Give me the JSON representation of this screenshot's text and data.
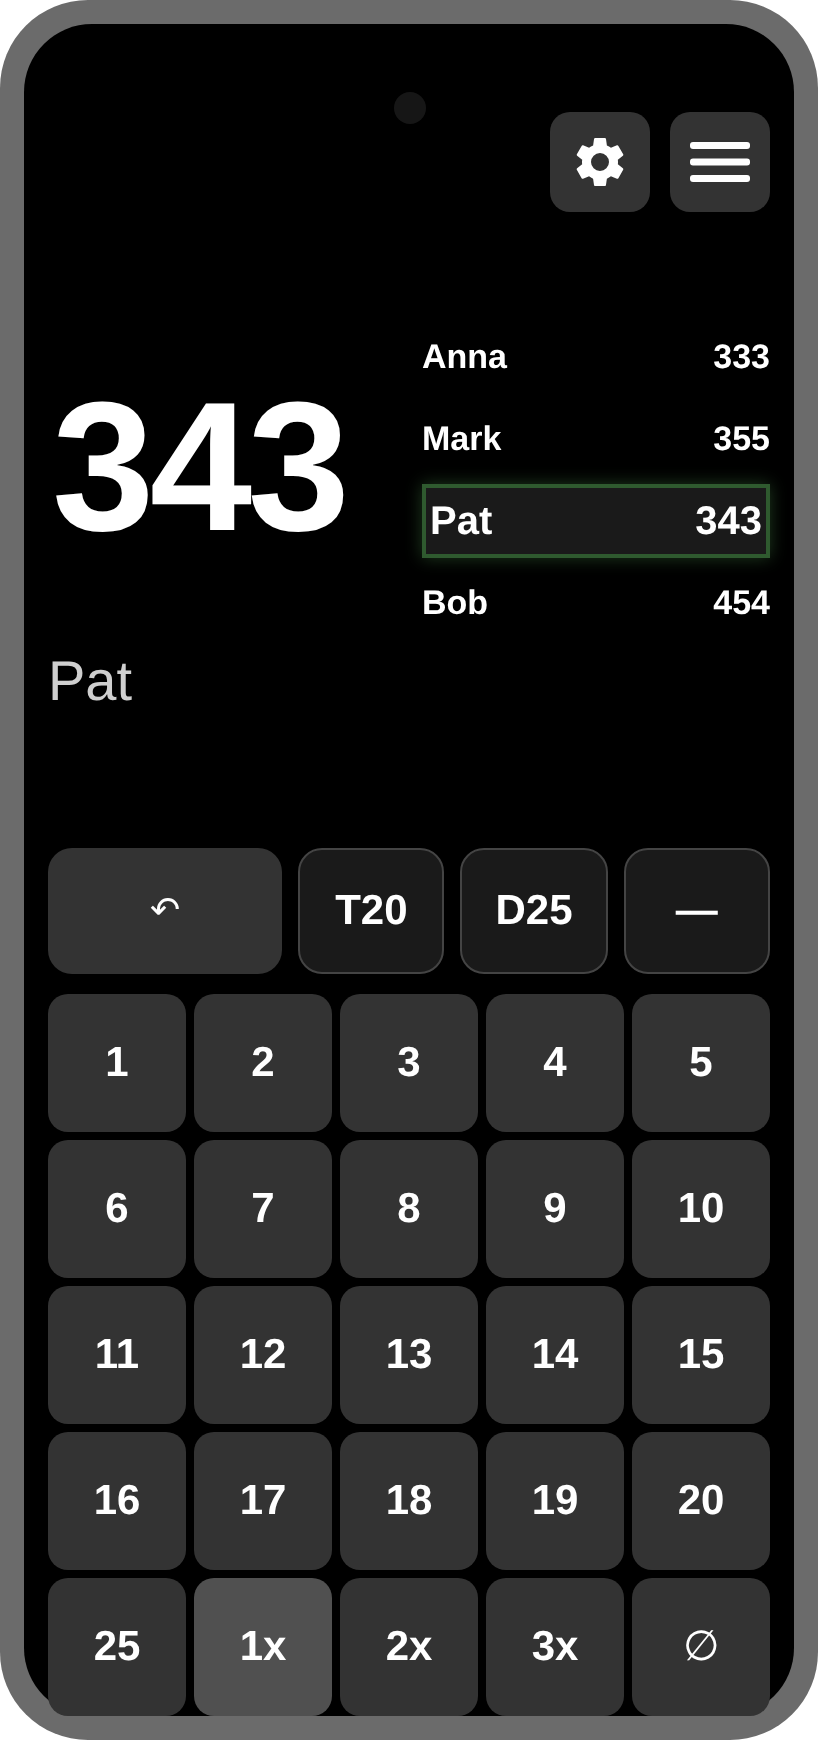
{
  "current_score": "343",
  "current_player": "Pat",
  "players": [
    {
      "name": "Anna",
      "score": "333",
      "selected": false
    },
    {
      "name": "Mark",
      "score": "355",
      "selected": false
    },
    {
      "name": "Pat",
      "score": "343",
      "selected": true
    },
    {
      "name": "Bob",
      "score": "454",
      "selected": false
    }
  ],
  "action_keys": [
    {
      "label": "↶",
      "kind": "undo"
    },
    {
      "label": "T20",
      "kind": "shortcut"
    },
    {
      "label": "D25",
      "kind": "shortcut"
    },
    {
      "label": "—",
      "kind": "shortcut"
    }
  ],
  "number_keys": [
    "1",
    "2",
    "3",
    "4",
    "5",
    "6",
    "7",
    "8",
    "9",
    "10",
    "11",
    "12",
    "13",
    "14",
    "15",
    "16",
    "17",
    "18",
    "19",
    "20",
    "25"
  ],
  "multipliers": [
    {
      "label": "1x",
      "selected": true
    },
    {
      "label": "2x",
      "selected": false
    },
    {
      "label": "3x",
      "selected": false
    }
  ],
  "miss_key": "∅"
}
